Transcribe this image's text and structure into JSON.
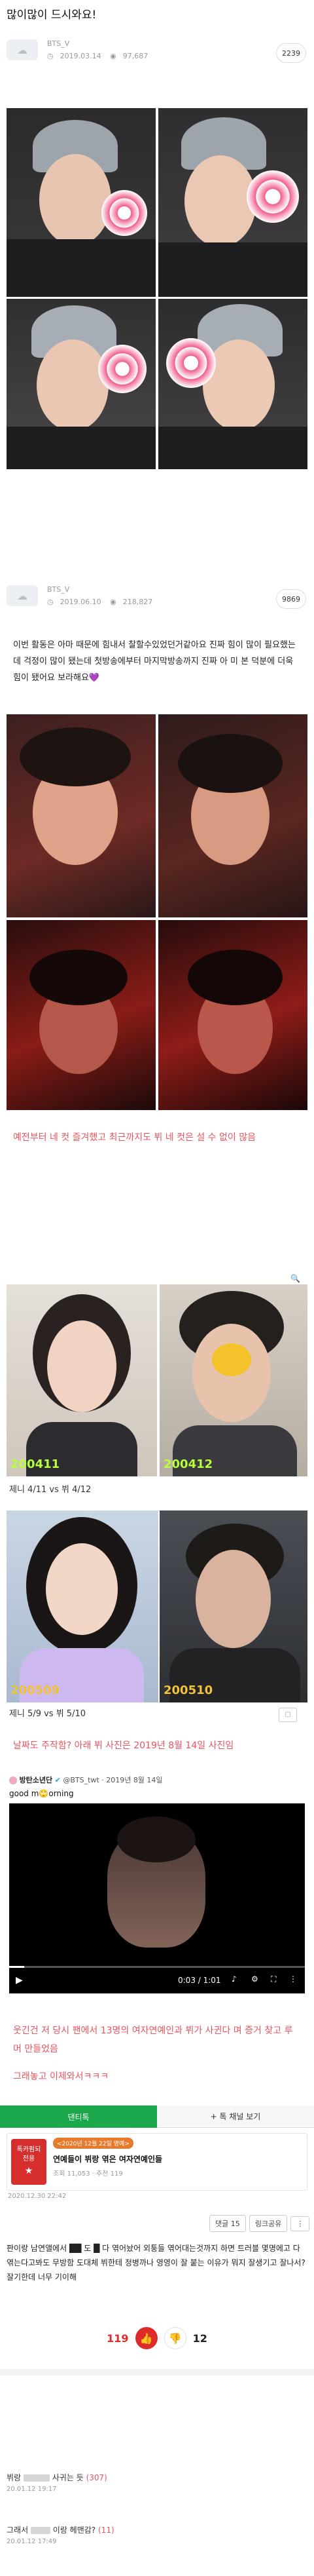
{
  "post1": {
    "title": "많이많이 드시와요!",
    "author": "BTS_V",
    "date": "2019.03.14",
    "views": "97,687",
    "count": "2239"
  },
  "post2": {
    "author": "BTS_V",
    "date": "2019.06.10",
    "views": "218,827",
    "count": "9869",
    "body": "이번 활동은 아마 때문에 힘내서 찰할수있었던거같아요 진짜 힘이 많이 필요했는데 걱정이 많이 됐는데 첫방송에부터 마지막방송까지 진짜 아 미 본 덕분에 더욱 힘이 됐어요 보라해요💜"
  },
  "pink1": "예전부터 네 컷 즐겨했고 최근까지도 뷔 네 컷은 설 수 없이 많음",
  "comparison1": {
    "left_date": "200411",
    "right_date": "200412",
    "caption": "제니 4/11 vs 뷔 4/12"
  },
  "comparison2": {
    "left_date": "200509",
    "right_date": "200510",
    "caption": "제니 5/9 vs 뷔 5/10"
  },
  "pink2": "날짜도 주작함? 아래 뷔 사진은 2019년 8월 14일 사진임",
  "tweet": {
    "account": "방탄소년단",
    "handle": "@BTS_twt",
    "date": "2019년 8월 14일",
    "text": "good m🙄orning",
    "time": "0:03 / 1:01"
  },
  "pink3": "웃긴건 저 당시 팬에서 13명의 여자연예인과 뷔가 사귄다 며 증거 찾고 루머 만들었음",
  "pink4": "그래놓고 이제와서ㅋㅋㅋ",
  "tabs": {
    "active": "댄티톡",
    "inactive": "+ 톡 채널 보기"
  },
  "card": {
    "badge_top": "<2020년 12월 22일 명예>",
    "badge_line1": "톡카펌되",
    "badge_line2": "전용",
    "headline": "연예들이 뷔랑 엮은 여자연예인들",
    "sub": "조회 11,053 · 추천 119",
    "date": "2020.12.30 22:42"
  },
  "actions": {
    "reply_btn": "댓글 15",
    "share_btn": "링크공유",
    "more_btn": "⋮"
  },
  "comment": {
    "text": "판이랑 남연앨에서 ██ 도 █ 다 엮어놨어 외퉁들 엮어대는것까지 하면 트러블 몇명에고 다 엮는다고봐도 무방함 도대체 뷔한테 정병까나 영영이 잘 붙는 이유가 뭐지 잘생기고 잘나서?잘기한데 너무 기이해"
  },
  "votes": {
    "up": "119",
    "down": "12",
    "up_color": "#e02b2b",
    "down_color": "#2a4fd8"
  },
  "replies": [
    {
      "name": "뷔랑",
      "text": "사귀는 듯",
      "count": "(307)",
      "date": "20.01.12 19:17"
    },
    {
      "name": "그래서",
      "text": "이랑 헤맨감?",
      "count": "(11)",
      "date": "20.01.12 17:49"
    }
  ]
}
